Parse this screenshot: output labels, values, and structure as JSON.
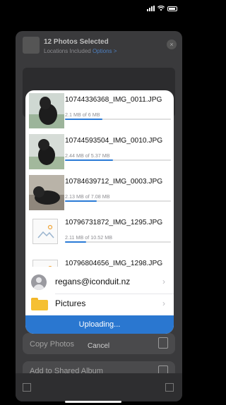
{
  "background_sheet": {
    "title": "12 Photos Selected",
    "subtitle": "Locations Included",
    "options_label": "Options >",
    "close_label": "×",
    "action_copy_photos": "Copy Photos",
    "action_shared_album": "Add to Shared Album"
  },
  "upload_dialog": {
    "files": [
      {
        "name": "10744336368_IMG_0011.JPG",
        "size": "2.1 MB of 6 MB",
        "progress": 0.35,
        "thumb": "dog-photo"
      },
      {
        "name": "10744593504_IMG_0010.JPG",
        "size": "2.44 MB of 5.37 MB",
        "progress": 0.45,
        "thumb": "dog-photo"
      },
      {
        "name": "10784639712_IMG_0003.JPG",
        "size": "2.13 MB of 7.08 MB",
        "progress": 0.3,
        "thumb": "dog-photo"
      },
      {
        "name": "10796731872_IMG_1295.JPG",
        "size": "2.11 MB of 10.52 MB",
        "progress": 0.2,
        "thumb": "image-placeholder"
      },
      {
        "name": "10796804656_IMG_1298.JPG",
        "size": "",
        "progress": 0,
        "thumb": "image-placeholder"
      }
    ],
    "account": "regans@iconduit.nz",
    "folder": "Pictures",
    "status": "Uploading..."
  },
  "cancel_label": "Cancel",
  "colors": {
    "accent": "#2a77d0",
    "folder": "#f5c033"
  }
}
